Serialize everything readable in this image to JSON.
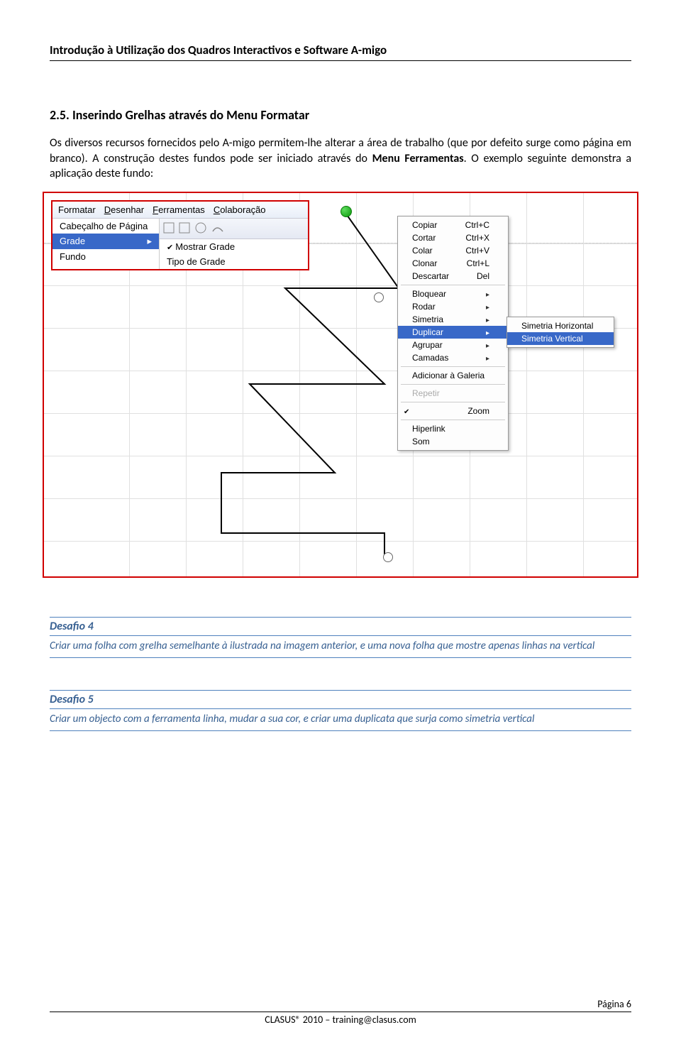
{
  "header": {
    "title": "Introdução à Utilização dos Quadros Interactivos e Software A-migo"
  },
  "section": {
    "number": "2.5.",
    "title": "Inserindo Grelhas através do Menu Formatar"
  },
  "paragraph": {
    "p1a": "Os diversos recursos fornecidos pelo A-migo permitem-lhe alterar a área de trabalho (que por defeito surge como página em branco). A construção destes fundos pode ser iniciado através do ",
    "p1b": "Menu Ferramentas",
    "p1c": ". O exemplo seguinte demonstra a aplicação deste fundo:"
  },
  "menubar": {
    "formatar": "Formatar",
    "desenhar": "Desenhar",
    "ferramentas": "Ferramentas",
    "colaboracao": "Colaboração"
  },
  "format_menu": {
    "cabecalho": "Cabeçalho de Página",
    "grade": "Grade",
    "fundo": "Fundo",
    "mostrar_grade": "Mostrar Grade",
    "tipo_grade": "Tipo de Grade"
  },
  "context_menu": {
    "copiar": "Copiar",
    "copiar_sc": "Ctrl+C",
    "cortar": "Cortar",
    "cortar_sc": "Ctrl+X",
    "colar": "Colar",
    "colar_sc": "Ctrl+V",
    "clonar": "Clonar",
    "clonar_sc": "Ctrl+L",
    "descartar": "Descartar",
    "descartar_sc": "Del",
    "bloquear": "Bloquear",
    "rodar": "Rodar",
    "simetria": "Simetria",
    "duplicar": "Duplicar",
    "agrupar": "Agrupar",
    "camadas": "Camadas",
    "adicionar_galeria": "Adicionar à Galeria",
    "repetir": "Repetir",
    "zoom": "Zoom",
    "hiperlink": "Hiperlink",
    "som": "Som"
  },
  "submenu": {
    "sim_h": "Simetria Horizontal",
    "sim_v": "Simetria Vertical"
  },
  "desafio4": {
    "title": "Desafio 4",
    "body": "Criar uma folha com grelha semelhante à ilustrada na imagem anterior, e uma nova folha que mostre apenas linhas na vertical"
  },
  "desafio5": {
    "title": "Desafio 5",
    "body": "Criar um objecto com a ferramenta linha, mudar a sua cor, e criar uma duplicata que surja como simetria vertical"
  },
  "footer": {
    "line": "CLASUS® 2010 – training@clasus.com",
    "page": "Página 6"
  }
}
